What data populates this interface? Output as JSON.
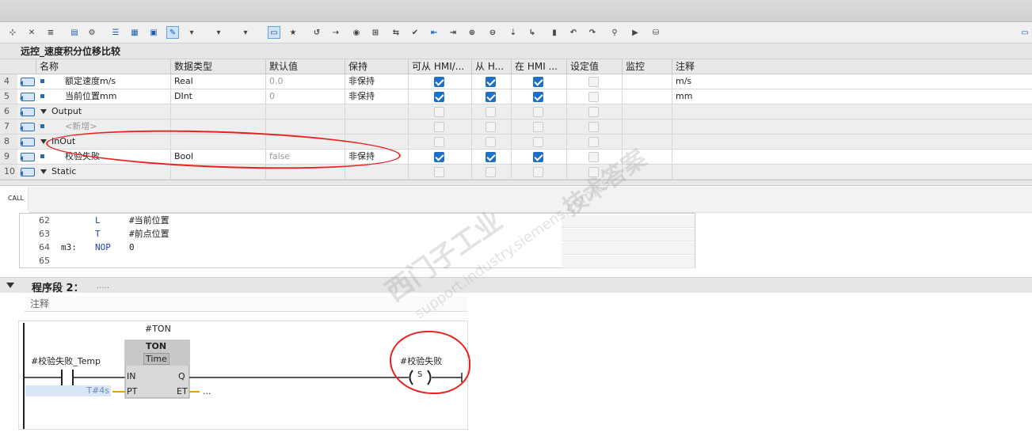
{
  "db_title": "远控_速度积分位移比较",
  "columns": [
    "名称",
    "数据类型",
    "默认值",
    "保持",
    "可从 HMI/...",
    "从 H...",
    "在 HMI ...",
    "设定值",
    "监控",
    "注释"
  ],
  "rows": [
    {
      "num": "4",
      "name": "额定速度m/s",
      "type": "Real",
      "default": "0.0",
      "retain": "非保持",
      "c1": true,
      "c2": true,
      "c3": true,
      "comment": "m/s",
      "kind": "item"
    },
    {
      "num": "5",
      "name": "当前位置mm",
      "type": "DInt",
      "default": "0",
      "retain": "非保持",
      "c1": true,
      "c2": true,
      "c3": true,
      "comment": "mm",
      "kind": "item"
    },
    {
      "num": "6",
      "name": "Output",
      "type": "",
      "default": "",
      "retain": "",
      "kind": "section"
    },
    {
      "num": "7",
      "name": "<新增>",
      "type": "",
      "default": "",
      "retain": "",
      "kind": "new"
    },
    {
      "num": "8",
      "name": "InOut",
      "type": "",
      "default": "",
      "retain": "",
      "kind": "section"
    },
    {
      "num": "9",
      "name": "校验失败",
      "type": "Bool",
      "default": "false",
      "retain": "非保持",
      "c1": true,
      "c2": true,
      "c3": true,
      "comment": "",
      "kind": "item"
    },
    {
      "num": "10",
      "name": "Static",
      "type": "",
      "default": "",
      "retain": "",
      "kind": "section"
    }
  ],
  "call_label": "CALL",
  "code_lines": [
    {
      "num": "62",
      "label": "",
      "op": "L",
      "arg": "#当前位置"
    },
    {
      "num": "63",
      "label": "",
      "op": "T",
      "arg": "#前点位置"
    },
    {
      "num": "64",
      "label": "m3:",
      "op": "NOP",
      "arg": "0"
    },
    {
      "num": "65",
      "label": "",
      "op": "",
      "arg": ""
    }
  ],
  "network": {
    "title": "程序段 2：",
    "comment_placeholder": ".....",
    "comment_label": "注释"
  },
  "ladder": {
    "instance": "#TON",
    "block_name": "TON",
    "block_type": "Time",
    "contact_var": "#校验失败_Temp",
    "pin_in": "IN",
    "pin_pt": "PT",
    "pin_q": "Q",
    "pin_et": "ET",
    "pt_value": "T#4s",
    "et_value": "...",
    "coil_var": "#校验失败",
    "coil_type": "S"
  },
  "watermark": {
    "line1": "西门子工业",
    "line2": "support.industry.siemens.com/cs",
    "line3": "技术答案"
  },
  "colors": {
    "accent": "#1e6fc6",
    "annotation": "#e82020"
  }
}
